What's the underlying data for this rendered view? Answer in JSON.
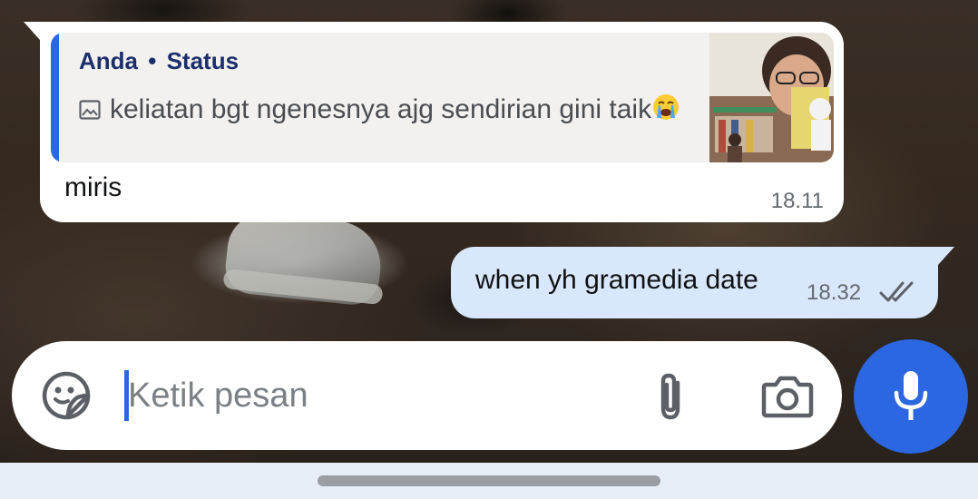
{
  "reply_message": {
    "quoted": {
      "sender": "Anda",
      "separator": "•",
      "context": "Status",
      "media_icon": "image-icon",
      "text": "keliatan bgt ngenesnya ajg sendirian gini taik",
      "emoji": "crying-face-emoji"
    },
    "text": "miris",
    "time": "18.11"
  },
  "sent_message": {
    "text": "when yh gramedia date",
    "time": "18.32",
    "status_icon": "double-check-icon"
  },
  "composer": {
    "placeholder": "Ketik pesan",
    "icons": [
      "sticker-icon",
      "paperclip-icon",
      "camera-icon",
      "microphone-icon"
    ]
  },
  "colors": {
    "accent": "#2b67e0",
    "quote_sender": "#1b2f6b",
    "outgoing_bubble": "#d8e7fb",
    "incoming_bubble": "#ffffff"
  }
}
